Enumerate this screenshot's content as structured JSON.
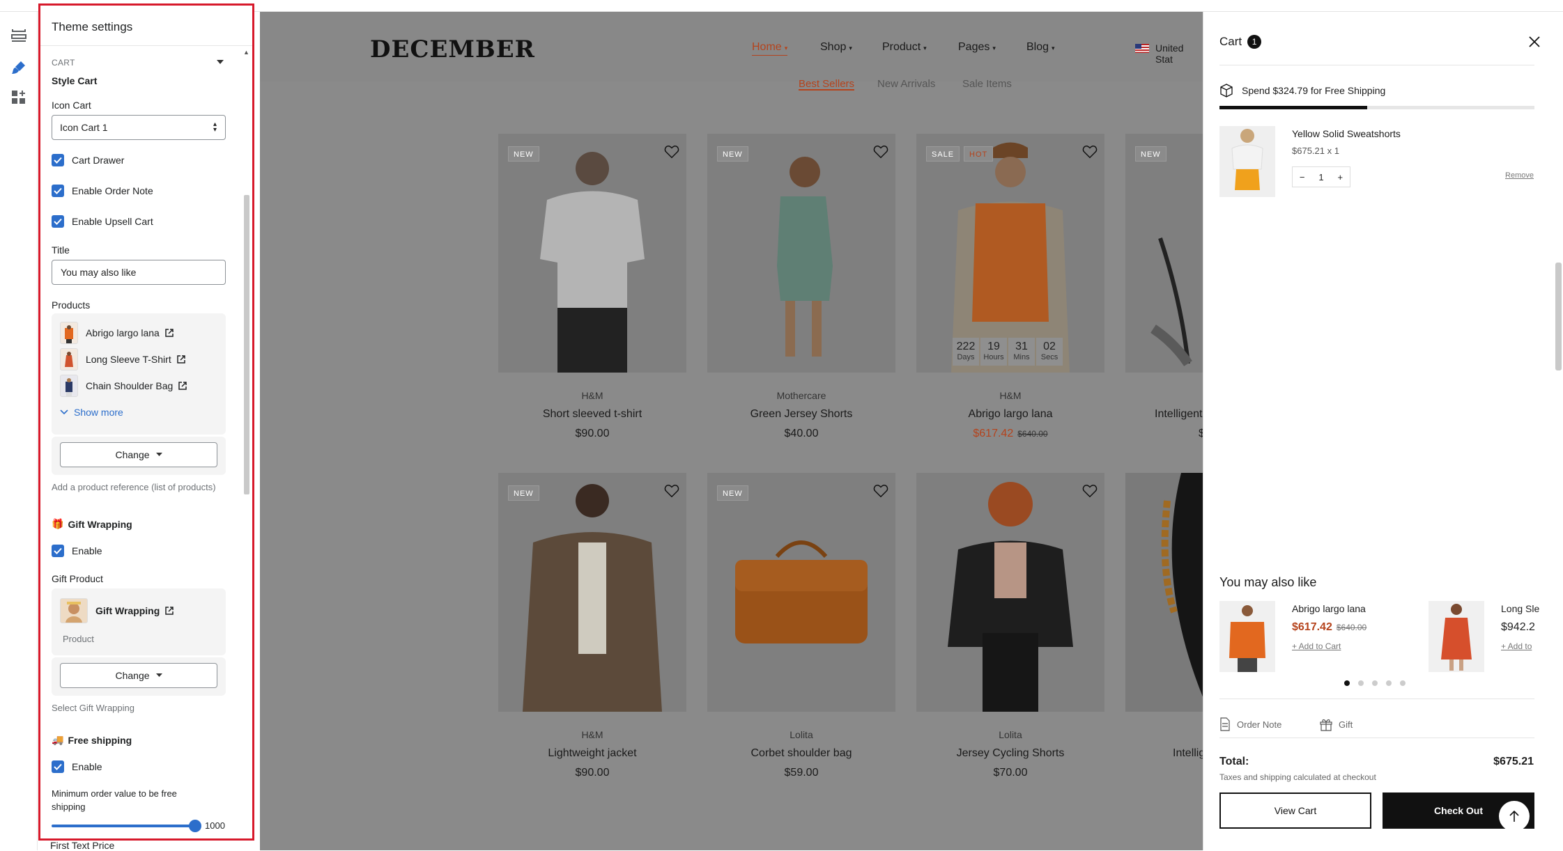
{
  "panel": {
    "title": "Theme settings",
    "section": "CART",
    "style_cart": "Style Cart",
    "icon_cart_label": "Icon Cart",
    "icon_cart_value": "Icon Cart 1",
    "cart_drawer": "Cart Drawer",
    "order_note": "Enable Order Note",
    "upsell": "Enable Upsell Cart",
    "title_label": "Title",
    "title_value": "You may also like",
    "products_label": "Products",
    "products": [
      "Abrigo largo lana",
      "Long Sleeve T-Shirt",
      "Chain Shoulder Bag"
    ],
    "show_more": "Show more",
    "change": "Change",
    "products_help": "Add a product reference (list of products)",
    "gift_heading": "Gift Wrapping",
    "gift_emoji": "🎁",
    "enable": "Enable",
    "gift_product_label": "Gift Product",
    "gift_product_name": "Gift Wrapping",
    "gift_product_type": "Product",
    "gift_help": "Select Gift Wrapping",
    "ship_heading": "Free shipping",
    "ship_emoji": "🚚",
    "min_order_label": "Minimum order value to be free shipping",
    "min_order_value": "1000",
    "min_order_fill": 1.0,
    "first_text_price": "First Text Price"
  },
  "store": {
    "logo": "DECEMBER",
    "nav": [
      "Home",
      "Shop",
      "Product",
      "Pages",
      "Blog"
    ],
    "country": "United Stat",
    "tabs": [
      "Best Sellers",
      "New Arrivals",
      "Sale Items"
    ],
    "products": [
      {
        "badge": "NEW",
        "badge2": "",
        "brand": "H&M",
        "name": "Short sleeved t-shirt",
        "price": "$90.00",
        "old": ""
      },
      {
        "badge": "NEW",
        "badge2": "",
        "brand": "Mothercare",
        "name": "Green Jersey Shorts",
        "price": "$40.00",
        "old": ""
      },
      {
        "badge": "SALE",
        "badge2": "HOT",
        "brand": "H&M",
        "name": "Abrigo largo lana",
        "price": "$617.42",
        "old": "$640.00"
      },
      {
        "badge": "NEW",
        "badge2": "",
        "brand": "",
        "name": "Intelligent",
        "price": "$",
        "old": ""
      },
      {
        "badge": "NEW",
        "badge2": "",
        "brand": "H&M",
        "name": "Lightweight jacket",
        "price": "$90.00",
        "old": ""
      },
      {
        "badge": "NEW",
        "badge2": "",
        "brand": "Lolita",
        "name": "Corbet shoulder bag",
        "price": "$59.00",
        "old": ""
      },
      {
        "badge": "",
        "badge2": "",
        "brand": "Lolita",
        "name": "Jersey Cycling Shorts",
        "price": "$70.00",
        "old": ""
      },
      {
        "badge": "",
        "badge2": "",
        "brand": "",
        "name": "Intellig",
        "price": "",
        "old": ""
      }
    ],
    "countdown": [
      {
        "v": "222",
        "l": "Days"
      },
      {
        "v": "19",
        "l": "Hours"
      },
      {
        "v": "31",
        "l": "Mins"
      },
      {
        "v": "02",
        "l": "Secs"
      }
    ]
  },
  "cart": {
    "title": "Cart",
    "count": "1",
    "ship_text": "Spend $324.79 for Free Shipping",
    "ship_progress": 0.47,
    "item_name": "Yellow Solid Sweatshorts",
    "item_price": "$675.21 x 1",
    "item_qty": "1",
    "remove": "Remove",
    "recommend_title": "You may also like",
    "rec1_name": "Abrigo largo lana",
    "rec1_price": "$617.42",
    "rec1_old": "$640.00",
    "add_to_cart": "+ Add to Cart",
    "rec2_name": "Long Sle",
    "rec2_price": "$942.2",
    "rec2_add": "+ Add to",
    "order_note": "Order Note",
    "gift": "Gift",
    "total_label": "Total:",
    "total_value": "$675.21",
    "tax_note": "Taxes and shipping calculated at checkout",
    "view_cart": "View Cart",
    "checkout": "Check Out"
  }
}
